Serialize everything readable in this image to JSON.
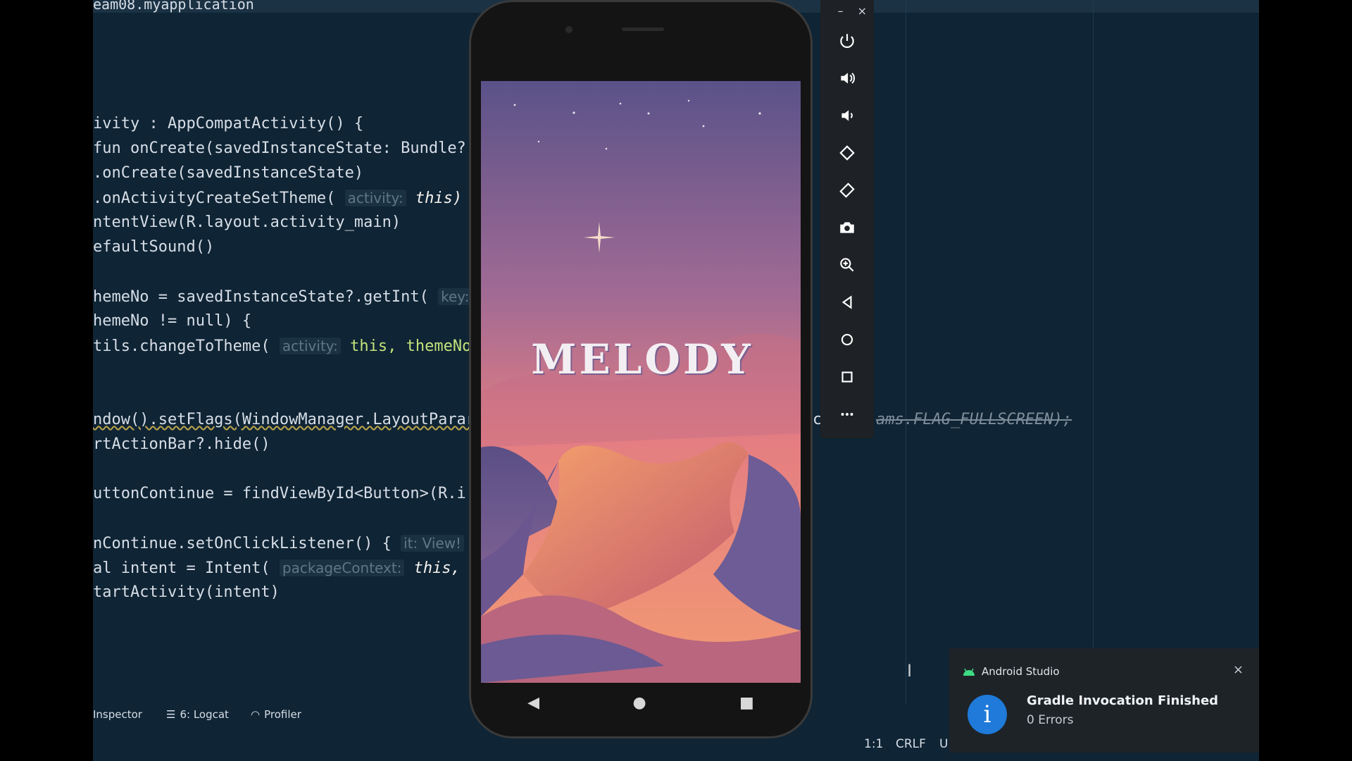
{
  "editor": {
    "file_title": "eam08.myapplication",
    "lines": [
      {
        "t": "ivity : AppCompatActivity() {"
      },
      {
        "t": "fun onCreate(savedInstanceState: Bundle?"
      },
      {
        "t": ".onCreate(savedInstanceState)"
      },
      {
        "t": ".onActivityCreateSetTheme( ",
        "hint": "activity:",
        "tail": " this)"
      },
      {
        "t": "ntentView(R.layout.activity_main)"
      },
      {
        "t": "efaultSound()"
      },
      {
        "t": "hemeNo = savedInstanceState?.getInt( ",
        "hint": "key:"
      },
      {
        "t": "hemeNo != null) {"
      },
      {
        "t": "tils.changeToTheme( ",
        "hint": "activity:",
        "tail": " this, themeNo)"
      },
      {
        "t": "ndow().setFlags(WindowManager.LayoutParar"
      },
      {
        "t": "rtActionBar?.hide()"
      },
      {
        "t": "uttonContinue = findViewById<Button>(R.i("
      },
      {
        "t": "nContinue.setOnClickListener() { ",
        "hint": "it: View!"
      },
      {
        "t": "al intent = Intent( ",
        "hint": "packageContext:",
        "tail": " this, Th"
      },
      {
        "t": "tartActivity(intent)"
      }
    ],
    "overflow_text_1": "c",
    "overflow_text_2": "ams.FLAG_FULLSCREEN);"
  },
  "bottom_tools": {
    "inspector": "Inspector",
    "logcat": "6: Logcat",
    "profiler": "Profiler"
  },
  "status": {
    "position": "1:1",
    "line_sep": "CRLF",
    "encoding": "U"
  },
  "emulator": {
    "minimize": "–",
    "close": "×",
    "buttons": [
      "power-icon",
      "volume-up-icon",
      "volume-down-icon",
      "rotate-left-icon",
      "rotate-right-icon",
      "camera-icon",
      "zoom-icon",
      "back-icon",
      "home-icon",
      "overview-icon",
      "more-icon"
    ]
  },
  "app_screen": {
    "logo_text": "MELODY"
  },
  "notification": {
    "app": "Android Studio",
    "title": "Gradle Invocation Finished",
    "subtitle": "0 Errors",
    "info_glyph": "i",
    "close": "×"
  },
  "colors": {
    "ide_bg": "#0f2434",
    "accent_scroll": "#7d6fd8",
    "info_blue": "#1f7ad9",
    "android_green": "#3ddc84"
  }
}
